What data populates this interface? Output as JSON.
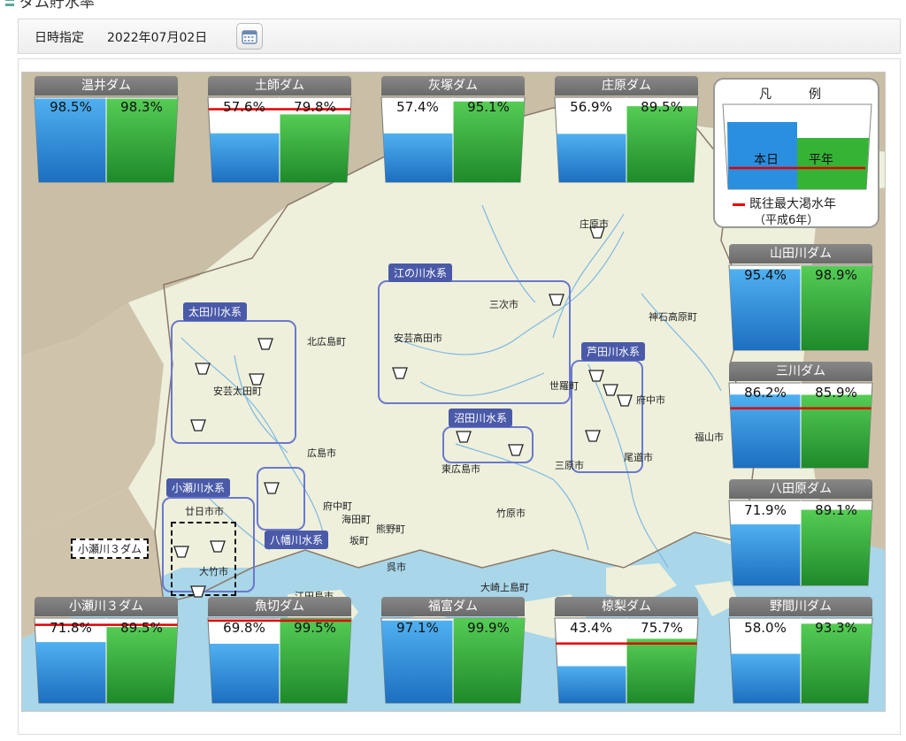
{
  "page": {
    "title": "ダム貯水率"
  },
  "date_bar": {
    "label": "日時指定",
    "date": "2022年07月02日"
  },
  "legend": {
    "title": "凡　例",
    "today": "本日",
    "normal": "平年",
    "note_line1": "既往最大渇水年",
    "note_line2": "（平成6年）"
  },
  "colors": {
    "today": "#2b8fe0",
    "normal": "#35b335",
    "record_line": "#e00000",
    "system_box": "#6b78cc"
  },
  "dams": [
    {
      "name": "温井ダム",
      "today": "98.5%",
      "normal": "98.3%",
      "today_frac": 0.985,
      "normal_frac": 0.983,
      "record_frac": null
    },
    {
      "name": "土師ダム",
      "today": "57.6%",
      "normal": "79.8%",
      "today_frac": 0.576,
      "normal_frac": 0.798,
      "record_frac": 0.86
    },
    {
      "name": "灰塚ダム",
      "today": "57.4%",
      "normal": "95.1%",
      "today_frac": 0.574,
      "normal_frac": 0.951,
      "record_frac": null
    },
    {
      "name": "庄原ダム",
      "today": "56.9%",
      "normal": "89.5%",
      "today_frac": 0.569,
      "normal_frac": 0.895,
      "record_frac": null
    },
    {
      "name": "山田川ダム",
      "today": "95.4%",
      "normal": "98.9%",
      "today_frac": 0.954,
      "normal_frac": 0.989,
      "record_frac": null
    },
    {
      "name": "三川ダム",
      "today": "86.2%",
      "normal": "85.9%",
      "today_frac": 0.862,
      "normal_frac": 0.859,
      "record_frac": 0.7
    },
    {
      "name": "八田原ダム",
      "today": "71.9%",
      "normal": "89.1%",
      "today_frac": 0.719,
      "normal_frac": 0.891,
      "record_frac": null
    },
    {
      "name": "小瀬川３ダム",
      "today": "71.8%",
      "normal": "89.5%",
      "today_frac": 0.718,
      "normal_frac": 0.895,
      "record_frac": 0.92
    },
    {
      "name": "魚切ダム",
      "today": "69.8%",
      "normal": "99.5%",
      "today_frac": 0.698,
      "normal_frac": 0.995,
      "record_frac": 0.97
    },
    {
      "name": "福富ダム",
      "today": "97.1%",
      "normal": "99.9%",
      "today_frac": 0.971,
      "normal_frac": 0.999,
      "record_frac": null
    },
    {
      "name": "椋梨ダム",
      "today": "43.4%",
      "normal": "75.7%",
      "today_frac": 0.434,
      "normal_frac": 0.757,
      "record_frac": 0.7
    },
    {
      "name": "野間川ダム",
      "today": "58.0%",
      "normal": "93.3%",
      "today_frac": 0.58,
      "normal_frac": 0.933,
      "record_frac": null
    }
  ],
  "systems": {
    "ota": "太田川水系",
    "gonokawa": "江の川水系",
    "ashida": "芦田川水系",
    "nuta": "沼田川水系",
    "oze": "小瀬川水系",
    "yahata": "八幡川水系",
    "oze3_tag": "小瀬川３ダム"
  },
  "cities": {
    "shobara": "庄原市",
    "jinseki": "神石高原町",
    "miyoshi": "三次市",
    "akitakata": "安芸高田市",
    "kitahiroshima": "北広島町",
    "akiota": "安芸太田町",
    "sera": "世羅町",
    "fuchu": "府中市",
    "fukuyama": "福山市",
    "mihara": "三原市",
    "onomichi": "尾道市",
    "hiroshima": "広島市",
    "higashihiroshima": "東広島市",
    "hatsukaichi": "廿日市市",
    "fuchu_cho": "府中町",
    "kaita": "海田町",
    "kumano": "熊野町",
    "saka": "坂町",
    "takehara": "竹原市",
    "kure": "呉市",
    "otake": "大竹市",
    "osakikamijima": "大崎上島町",
    "etajima": "江田島市"
  }
}
